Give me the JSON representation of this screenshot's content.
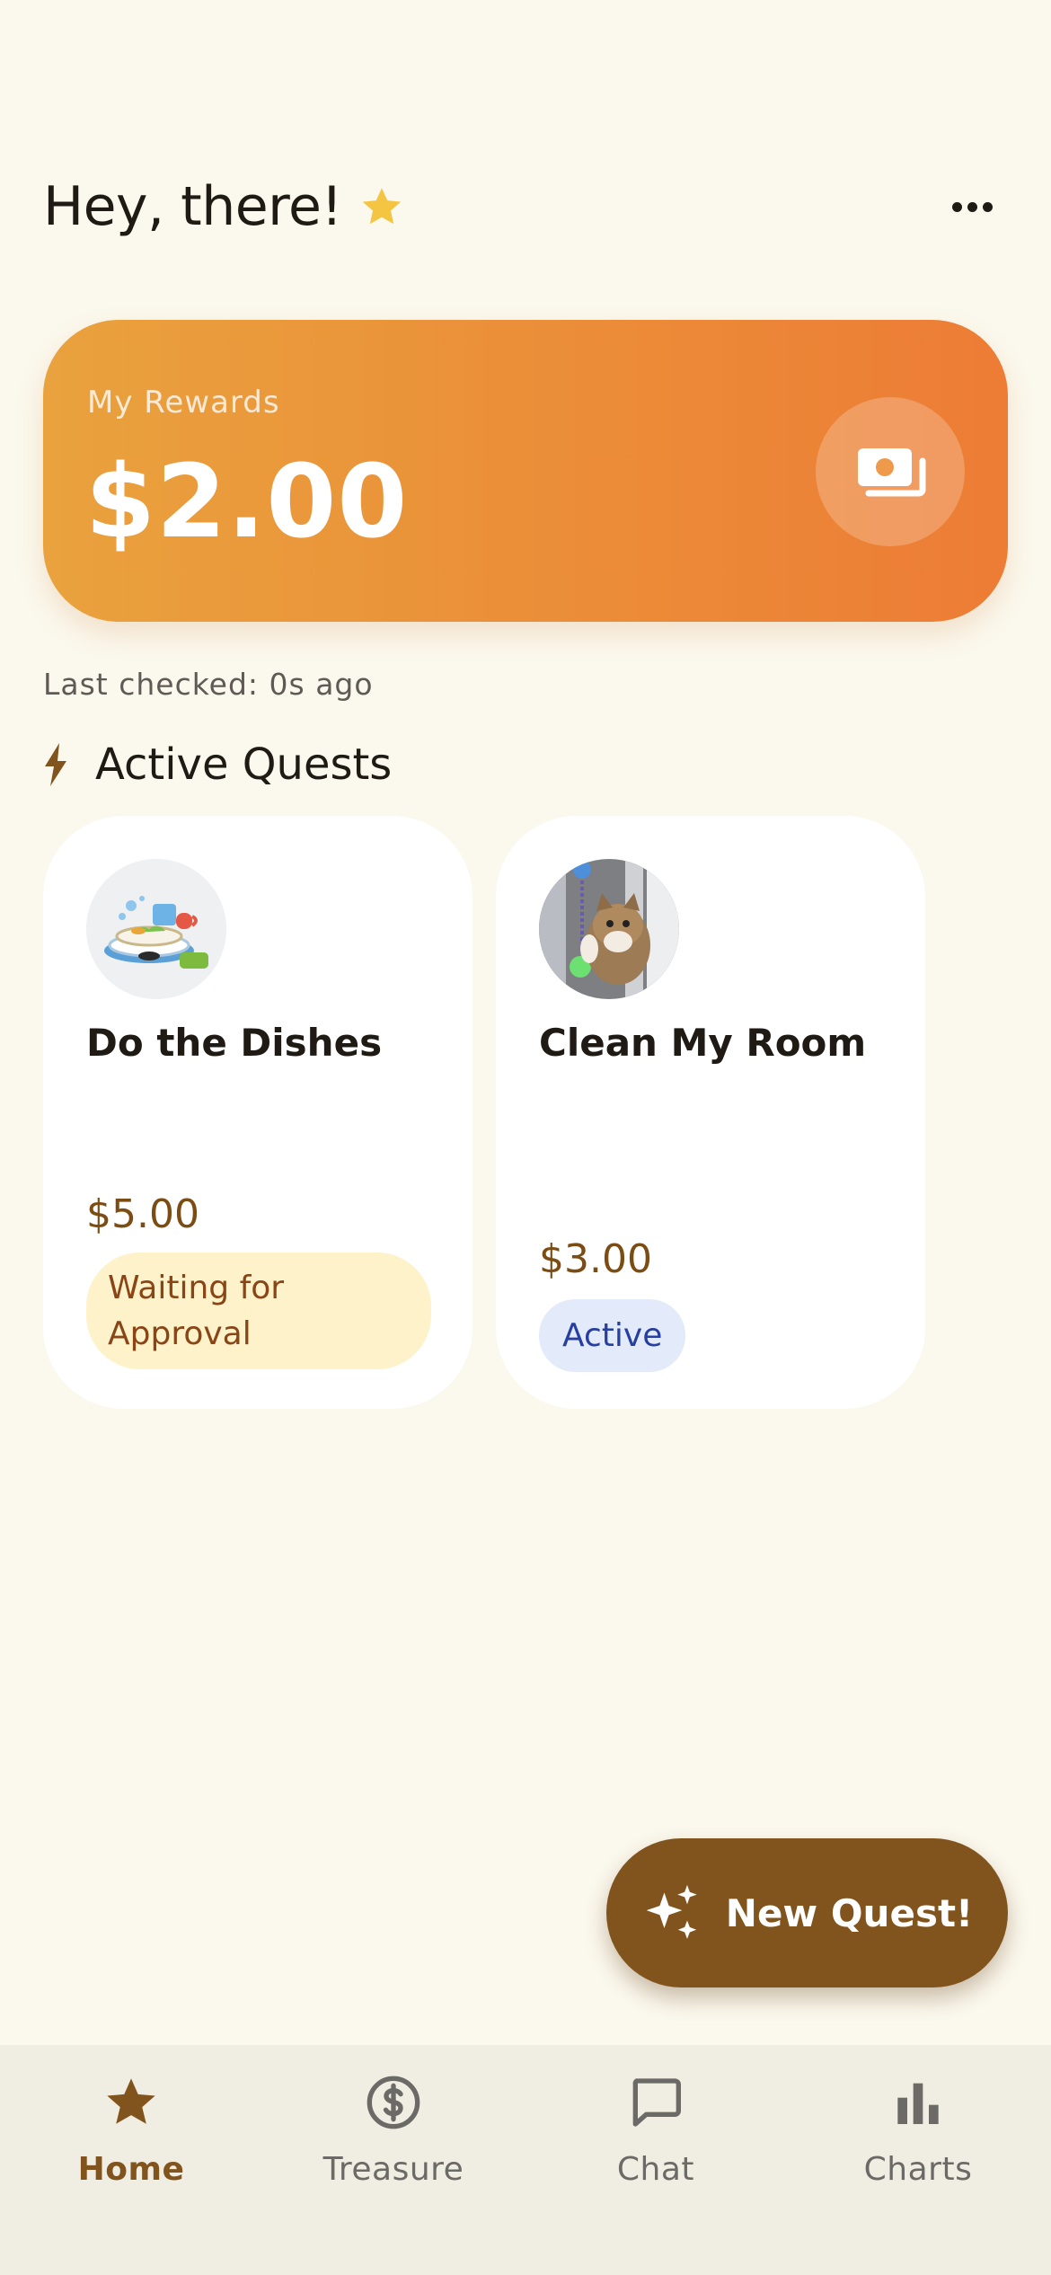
{
  "header": {
    "greeting": "Hey, there!",
    "greeting_icon": "star-icon",
    "menu_icon": "more-horizontal-icon"
  },
  "rewards": {
    "label": "My Rewards",
    "amount": "$2.00",
    "icon": "cash-icon"
  },
  "last_checked": "Last checked: 0s ago",
  "active_quests": {
    "title": "Active Quests",
    "icon": "lightning-icon",
    "items": [
      {
        "title": "Do the Dishes",
        "price": "$5.00",
        "status": "Waiting for Approval",
        "image": "dishes-illustration"
      },
      {
        "title": "Clean My Room",
        "price": "$3.00",
        "status": "Active",
        "image": "cat-photo"
      }
    ]
  },
  "fab": {
    "label": "New Quest!",
    "icon": "sparkles-icon"
  },
  "nav": {
    "items": [
      {
        "label": "Home",
        "icon": "star-icon"
      },
      {
        "label": "Treasure",
        "icon": "dollar-circle-icon"
      },
      {
        "label": "Chat",
        "icon": "chat-bubble-icon"
      },
      {
        "label": "Charts",
        "icon": "bar-chart-icon"
      }
    ]
  },
  "colors": {
    "background": "#fbf8ed",
    "brand_brown": "#82541d",
    "gradient_start": "#e9a23d",
    "gradient_end": "#ed7c35",
    "waiting_bg": "#fdf2c9",
    "active_bg": "#e3ebfb"
  }
}
